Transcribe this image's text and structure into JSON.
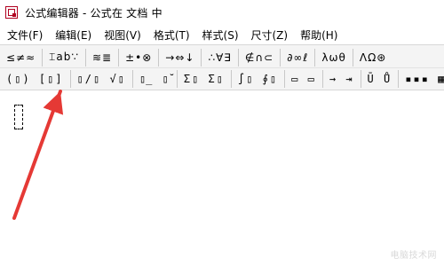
{
  "window": {
    "title": "公式编辑器 - 公式在 文档 中",
    "app_icon": "equation-editor-app-icon"
  },
  "menubar": {
    "items": [
      "文件(F)",
      "编辑(E)",
      "视图(V)",
      "格式(T)",
      "样式(S)",
      "尺寸(Z)",
      "帮助(H)"
    ]
  },
  "toolbar": {
    "row1": [
      "≤≠≈",
      "⌶ab∵",
      "≋≣",
      "±•⊗",
      "→⇔↓",
      "∴∀∃",
      "∉∩⊂",
      "∂∞ℓ",
      "λωθ",
      "ΛΩ⊛"
    ],
    "row2": [
      "(▯) [▯]",
      "▯/▯ √▯",
      "▯̲ ▯̆",
      "Σ▯ Σ▯",
      "∫▯ ∮▯",
      "▭ ▭",
      "→ ⇥",
      "Ū Ů",
      "▪▪▪ ▦"
    ]
  },
  "annotation": {
    "arrow_color": "#e53935"
  },
  "watermark": {
    "text": "电脑技术网"
  }
}
